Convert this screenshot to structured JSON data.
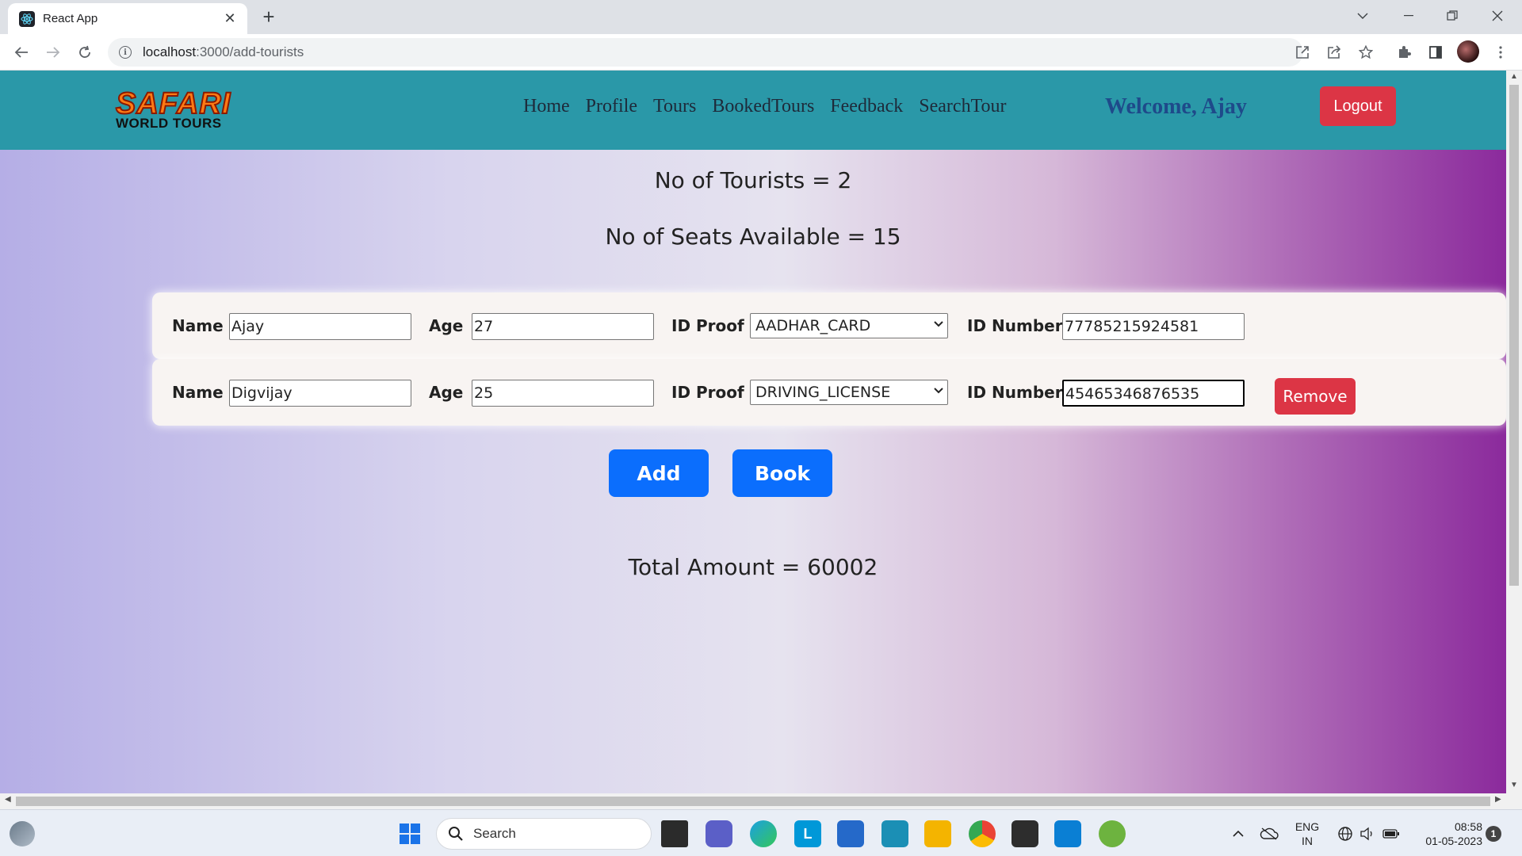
{
  "browser": {
    "tab_title": "React App",
    "url_host": "localhost",
    "url_rest": ":3000/add-tourists",
    "new_tab": "+",
    "tab_close": "✕"
  },
  "app": {
    "logo_line1": "SAFARI",
    "logo_line2": "WORLD TOURS",
    "nav": [
      "Home",
      "Profile",
      "Tours",
      "BookedTours",
      "Feedback",
      "SearchTour"
    ],
    "welcome": "Welcome, Ajay",
    "logout_label": "Logout"
  },
  "summary": {
    "tourists_line": "No of Tourists = 2",
    "seats_line": "No of Seats Available = 15",
    "total_line": "Total Amount = 60002"
  },
  "labels": {
    "name": "Name",
    "age": "Age",
    "id_proof": "ID Proof",
    "id_number": "ID Number",
    "remove": "Remove"
  },
  "tourists": [
    {
      "name": "Ajay",
      "age": "27",
      "id_proof": "AADHAR_CARD",
      "id_number": "77785215924581"
    },
    {
      "name": "Digvijay",
      "age": "25",
      "id_proof": "DRIVING_LICENSE",
      "id_number": "45465346876535"
    }
  ],
  "actions": {
    "add_label": "Add",
    "book_label": "Book"
  },
  "taskbar": {
    "search_placeholder": "Search",
    "lang_top": "ENG",
    "lang_bottom": "IN",
    "time": "08:58",
    "date": "01-05-2023",
    "notification_count": "1"
  },
  "colors": {
    "navbar": "#2a98a8",
    "danger": "#dc3545",
    "primary": "#0b6efd"
  }
}
